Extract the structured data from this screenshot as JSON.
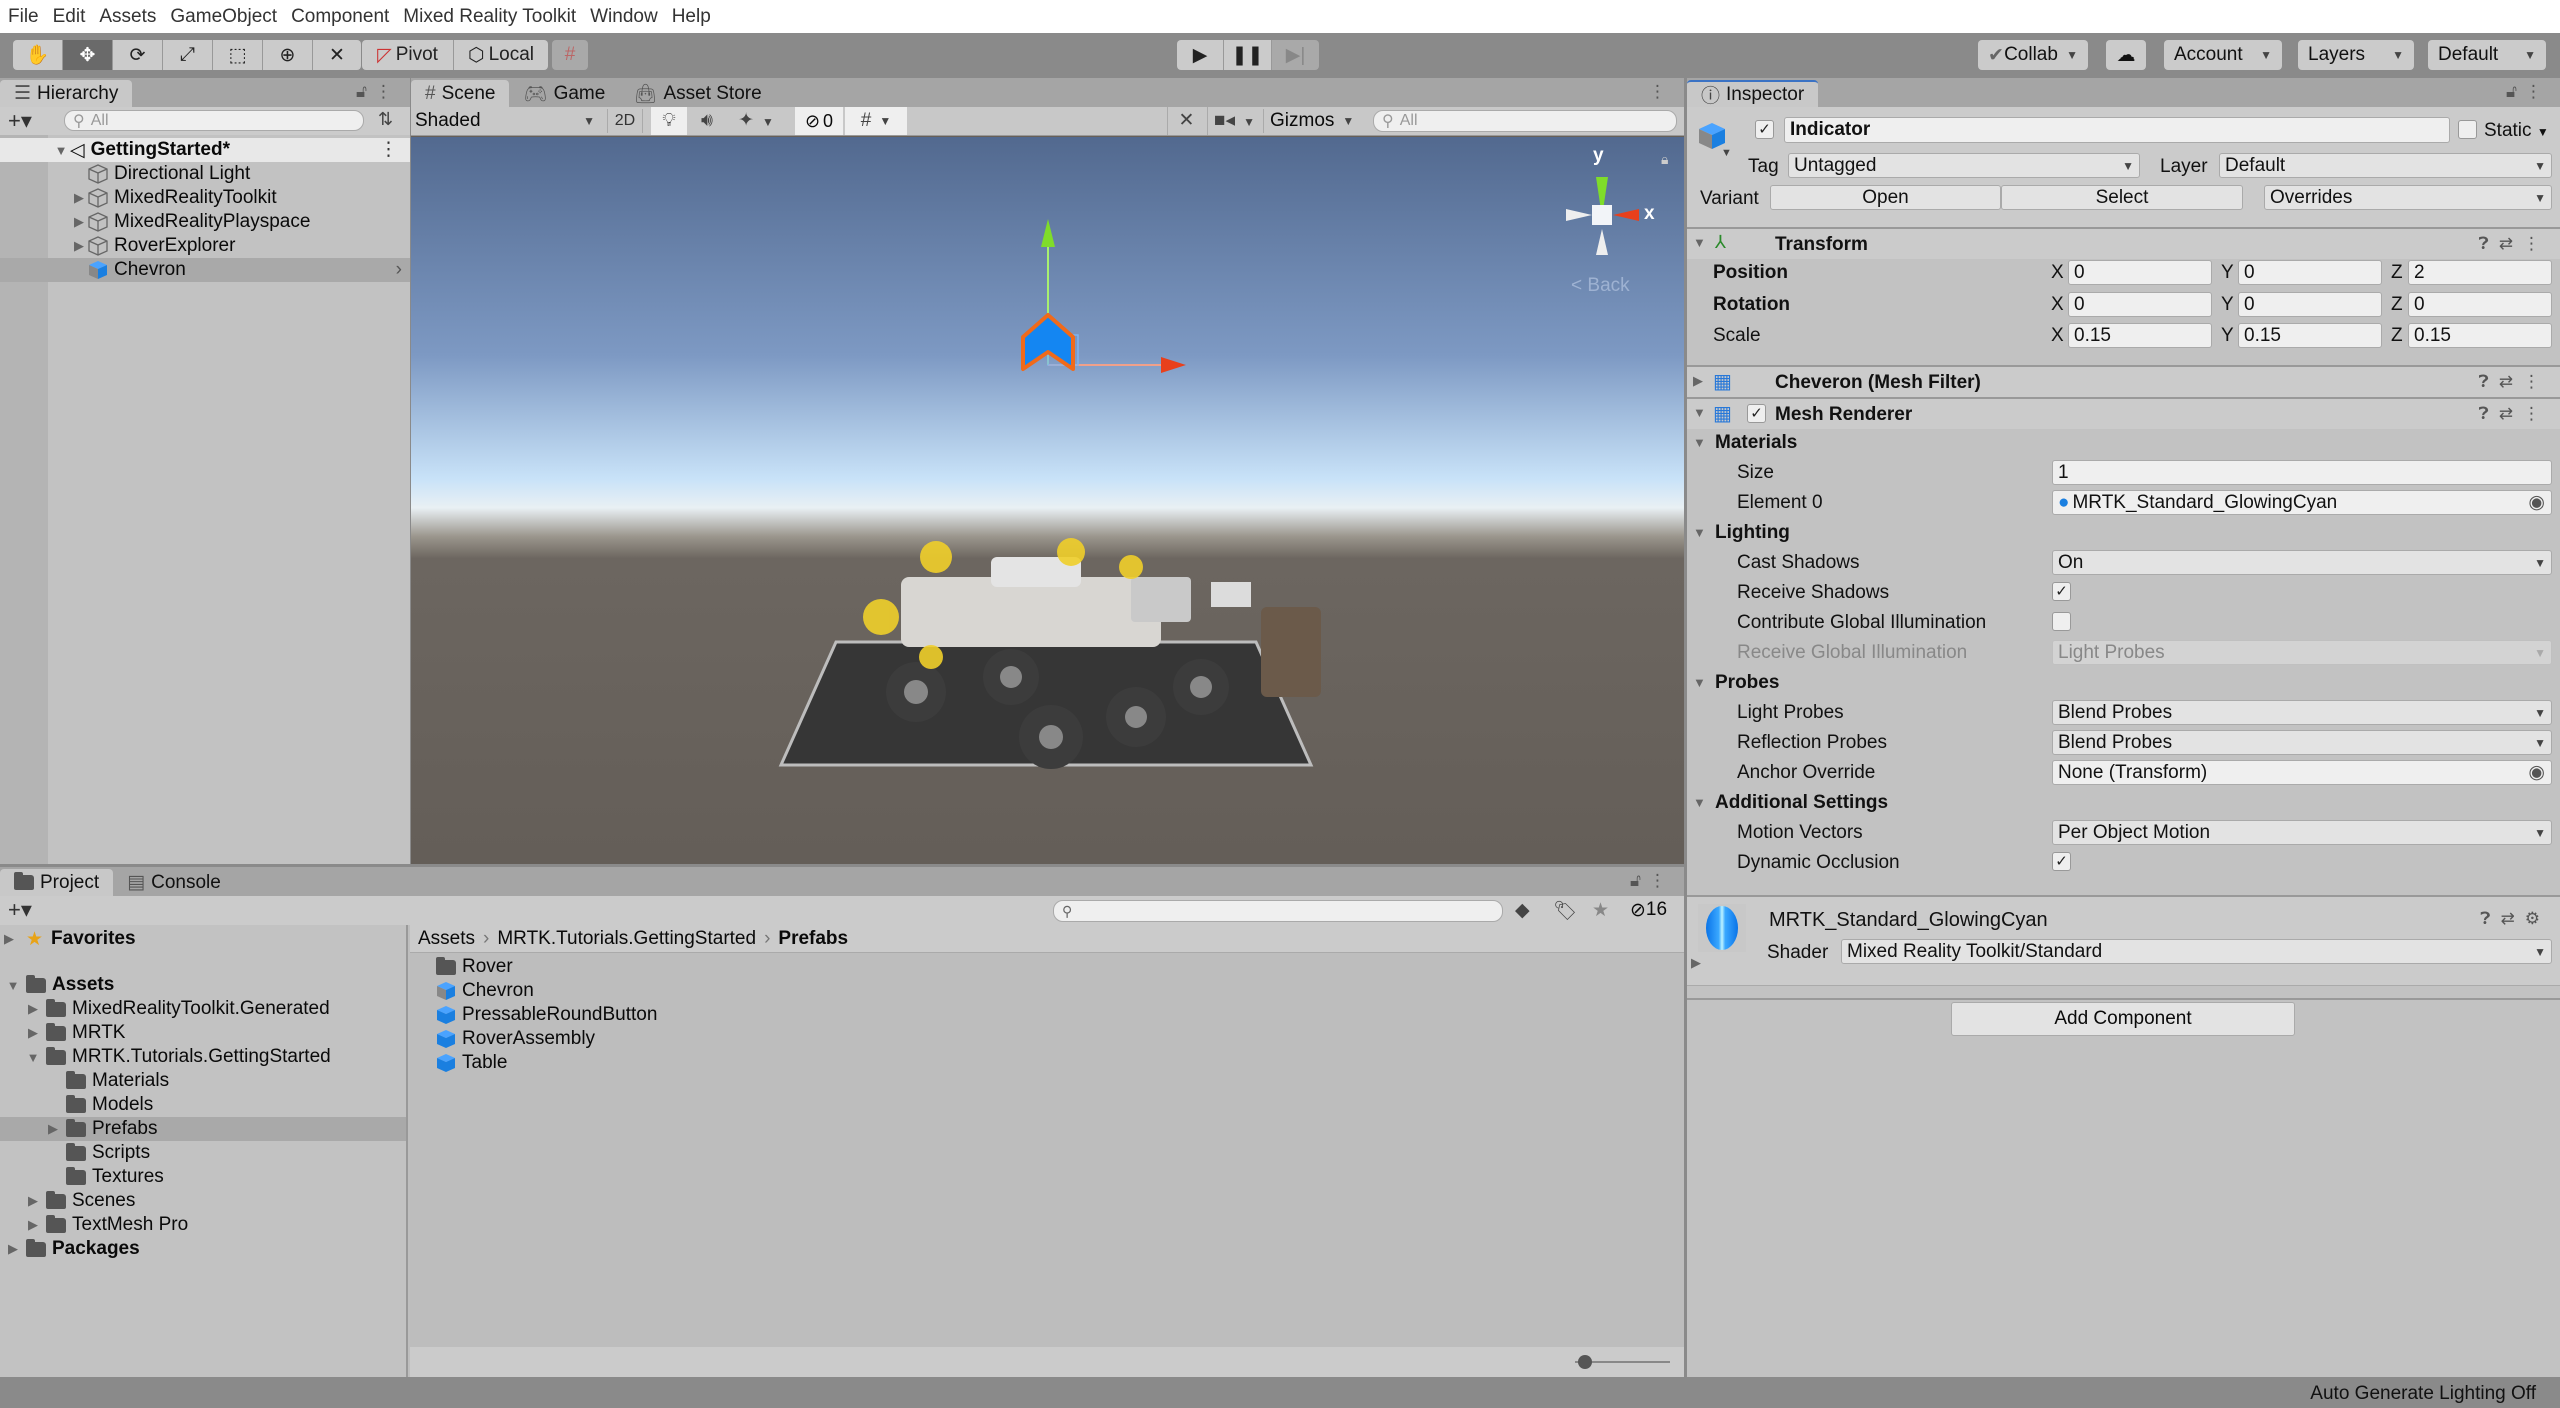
{
  "menu": [
    "File",
    "Edit",
    "Assets",
    "GameObject",
    "Component",
    "Mixed Reality Toolkit",
    "Window",
    "Help"
  ],
  "toolbar": {
    "tools": [
      "hand-tool",
      "move-tool",
      "rotate-tool",
      "scale-tool",
      "rect-tool",
      "transform-tool",
      "custom-tool"
    ],
    "active_tool": "move-tool",
    "pivot_label": "Pivot",
    "local_label": "Local",
    "collab_label": "Collab",
    "account_label": "Account",
    "layers_label": "Layers",
    "layout_label": "Default"
  },
  "hierarchy": {
    "tab_label": "Hierarchy",
    "search_placeholder": "All",
    "scene_name": "GettingStarted*",
    "items": [
      {
        "label": "Directional Light",
        "expandable": false
      },
      {
        "label": "MixedRealityToolkit",
        "expandable": true
      },
      {
        "label": "MixedRealityPlayspace",
        "expandable": true
      },
      {
        "label": "RoverExplorer",
        "expandable": true
      },
      {
        "label": "Chevron",
        "expandable": false,
        "selected": true,
        "prefab": true
      }
    ]
  },
  "scene": {
    "tabs": [
      "Scene",
      "Game",
      "Asset Store"
    ],
    "active_tab": "Scene",
    "shading_mode": "Shaded",
    "mode_2d": "2D",
    "hidden_count": "0",
    "gizmos_label": "Gizmos",
    "search_placeholder": "All",
    "axis_y": "y",
    "axis_x": "x",
    "back_label": "Back"
  },
  "inspector": {
    "tab_label": "Inspector",
    "object_name": "Indicator",
    "active": true,
    "static_label": "Static",
    "static": false,
    "tag_label": "Tag",
    "tag_value": "Untagged",
    "layer_label": "Layer",
    "layer_value": "Default",
    "variant_label": "Variant",
    "open_label": "Open",
    "select_label": "Select",
    "overrides_label": "Overrides",
    "transform": {
      "title": "Transform",
      "rows": [
        {
          "label": "Position",
          "x": "0",
          "y": "0",
          "z": "2"
        },
        {
          "label": "Rotation",
          "x": "0",
          "y": "0",
          "z": "0"
        },
        {
          "label": "Scale",
          "x": "0.15",
          "y": "0.15",
          "z": "0.15"
        }
      ]
    },
    "mesh_filter_title": "Cheveron (Mesh Filter)",
    "mesh_renderer": {
      "title": "Mesh Renderer",
      "enabled": true,
      "materials_label": "Materials",
      "size_label": "Size",
      "size_value": "1",
      "element0_label": "Element 0",
      "element0_value": "MRTK_Standard_GlowingCyan",
      "lighting_label": "Lighting",
      "cast_shadows_label": "Cast Shadows",
      "cast_shadows_value": "On",
      "receive_shadows_label": "Receive Shadows",
      "receive_shadows": true,
      "contribute_gi_label": "Contribute Global Illumination",
      "contribute_gi": false,
      "receive_gi_label": "Receive Global Illumination",
      "receive_gi_value": "Light Probes",
      "probes_label": "Probes",
      "light_probes_label": "Light Probes",
      "light_probes_value": "Blend Probes",
      "reflection_probes_label": "Reflection Probes",
      "reflection_probes_value": "Blend Probes",
      "anchor_override_label": "Anchor Override",
      "anchor_override_value": "None (Transform)",
      "additional_label": "Additional Settings",
      "motion_vectors_label": "Motion Vectors",
      "motion_vectors_value": "Per Object Motion",
      "dynamic_occlusion_label": "Dynamic Occlusion",
      "dynamic_occlusion": true
    },
    "material": {
      "name": "MRTK_Standard_GlowingCyan",
      "shader_label": "Shader",
      "shader_value": "Mixed Reality Toolkit/Standard"
    },
    "add_component_label": "Add Component"
  },
  "project": {
    "tabs": [
      "Project",
      "Console"
    ],
    "active_tab": "Project",
    "hidden_count": "16",
    "favorites_label": "Favorites",
    "tree": [
      {
        "label": "Assets",
        "level": 0,
        "bold": true,
        "open": true
      },
      {
        "label": "MixedRealityToolkit.Generated",
        "level": 1,
        "expandable": true
      },
      {
        "label": "MRTK",
        "level": 1,
        "expandable": true
      },
      {
        "label": "MRTK.Tutorials.GettingStarted",
        "level": 1,
        "expandable": true,
        "open": true
      },
      {
        "label": "Materials",
        "level": 2
      },
      {
        "label": "Models",
        "level": 2
      },
      {
        "label": "Prefabs",
        "level": 2,
        "expandable": true,
        "selected": true
      },
      {
        "label": "Scripts",
        "level": 2
      },
      {
        "label": "Textures",
        "level": 2
      },
      {
        "label": "Scenes",
        "level": 1,
        "expandable": true
      },
      {
        "label": "TextMesh Pro",
        "level": 1,
        "expandable": true
      },
      {
        "label": "Packages",
        "level": 0,
        "bold": true,
        "expandable": true
      }
    ],
    "breadcrumb": [
      "Assets",
      "MRTK.Tutorials.GettingStarted",
      "Prefabs"
    ],
    "files": [
      {
        "label": "Rover",
        "type": "folder"
      },
      {
        "label": "Chevron",
        "type": "prefab-variant"
      },
      {
        "label": "PressableRoundButton",
        "type": "prefab"
      },
      {
        "label": "RoverAssembly",
        "type": "prefab"
      },
      {
        "label": "Table",
        "type": "prefab"
      }
    ]
  },
  "status_bar": {
    "text": "Auto Generate Lighting Off"
  },
  "colors": {
    "prefab_blue": "#1a7fe0",
    "selection": "#a9a9a9",
    "gizmo_x": "#e8401c",
    "gizmo_y": "#7fdc2a",
    "chevron_fill": "#1486f2",
    "chevron_outline": "#f06a1a"
  }
}
